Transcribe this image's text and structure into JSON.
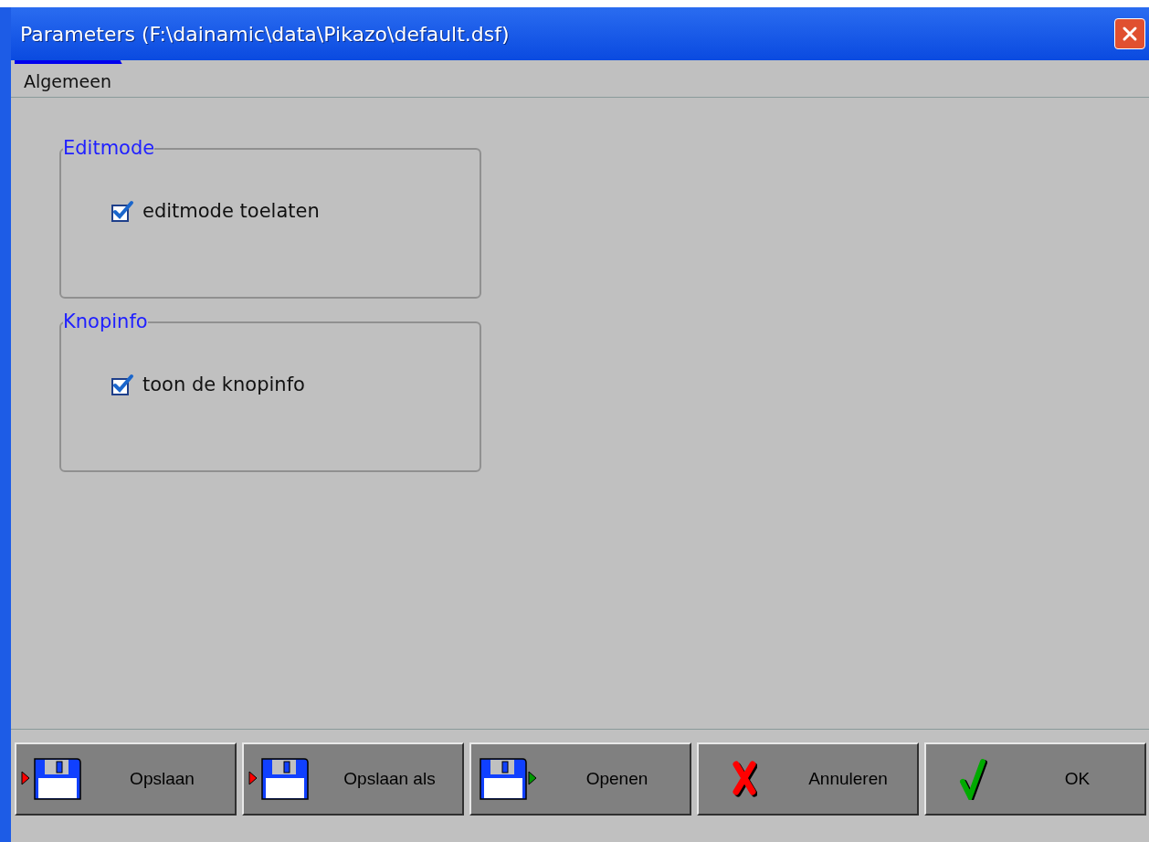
{
  "window": {
    "title": "Parameters (F:\\dainamic\\data\\Pikazo\\default.dsf)"
  },
  "tabs": [
    {
      "label": "Algemeen",
      "selected": true
    }
  ],
  "groups": [
    {
      "title": "Editmode",
      "option": {
        "label": "editmode toelaten",
        "checked": true
      }
    },
    {
      "title": "Knopinfo",
      "option": {
        "label": "toon de knopinfo",
        "checked": true
      }
    }
  ],
  "buttons": [
    {
      "label": "Opslaan",
      "kind": "save"
    },
    {
      "label": "Opslaan als",
      "kind": "save-as"
    },
    {
      "label": "Openen",
      "kind": "open"
    },
    {
      "label": "Annuleren",
      "kind": "cancel"
    },
    {
      "label": "OK",
      "kind": "ok"
    }
  ]
}
